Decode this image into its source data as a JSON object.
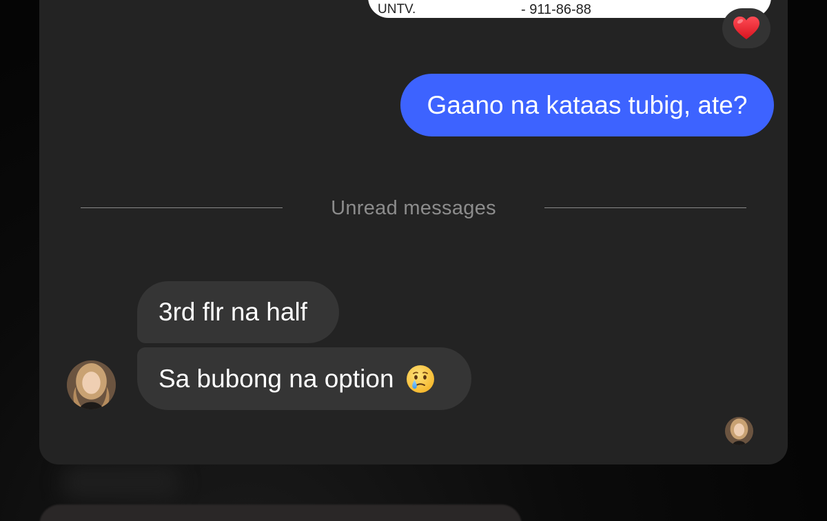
{
  "conversation": {
    "shared_image": {
      "source_text": "UNTV.",
      "phone_text": "- 911-86-88"
    },
    "reaction": {
      "icon": "red-heart-icon",
      "color": "#e0202c"
    },
    "outgoing_message": {
      "text": "Gaano na kataas tubig, ate?",
      "color": "#3d63ff"
    },
    "divider": {
      "label": "Unread messages"
    },
    "incoming_messages": [
      {
        "text": "3rd flr na half"
      },
      {
        "text": "Sa bubong na option",
        "emoji": "crying-face-emoji"
      }
    ],
    "sender_avatar": {
      "icon": "contact-avatar"
    },
    "seen_avatar": {
      "icon": "seen-receipt-avatar"
    }
  }
}
